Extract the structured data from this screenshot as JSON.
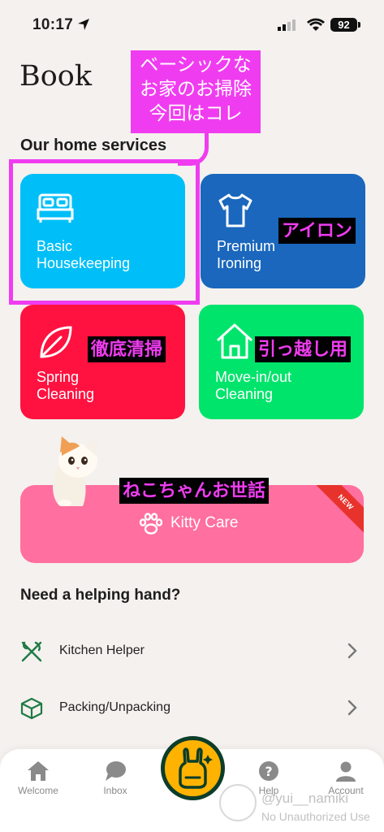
{
  "status_bar": {
    "time": "10:17",
    "battery": "92"
  },
  "page": {
    "title": "Book"
  },
  "annotations": {
    "callout": "ベーシックな\nお家のお掃除\n今回はコレ",
    "ironing": "アイロン",
    "spring": "徹底清掃",
    "move": "引っ越し用",
    "kitty": "ねこちゃんお世話"
  },
  "sections": {
    "home_services": "Our home services",
    "helping_hand": "Need a helping hand?"
  },
  "services": [
    {
      "label": "Basic\nHousekeeping",
      "color": "#00bff8",
      "icon": "bed-icon"
    },
    {
      "label": "Premium\nIroning",
      "color": "#1a67bd",
      "icon": "shirt-icon"
    },
    {
      "label": "Spring\nCleaning",
      "color": "#ff1240",
      "icon": "leaf-icon"
    },
    {
      "label": "Move-in/out\nCleaning",
      "color": "#00e46b",
      "icon": "house-icon"
    }
  ],
  "kitty_care": {
    "label": "Kitty Care",
    "badge": "NEW",
    "color": "#ff6fa0",
    "icon": "paw-icon"
  },
  "helpers": [
    {
      "label": "Kitchen Helper",
      "icon": "utensils-icon"
    },
    {
      "label": "Packing/Unpacking",
      "icon": "box-icon"
    }
  ],
  "tabs": [
    {
      "label": "Welcome",
      "icon": "home-icon"
    },
    {
      "label": "Inbox",
      "icon": "chat-icon"
    },
    {
      "label": "Help",
      "icon": "help-icon"
    },
    {
      "label": "Account",
      "icon": "person-icon"
    }
  ],
  "watermark": {
    "line1": "@yui__namiki",
    "line2": "No Unauthorized Use"
  },
  "colors": {
    "accent_annotation": "#f03cf0",
    "background": "#f4f1ee",
    "center_button": "#ffb300"
  }
}
